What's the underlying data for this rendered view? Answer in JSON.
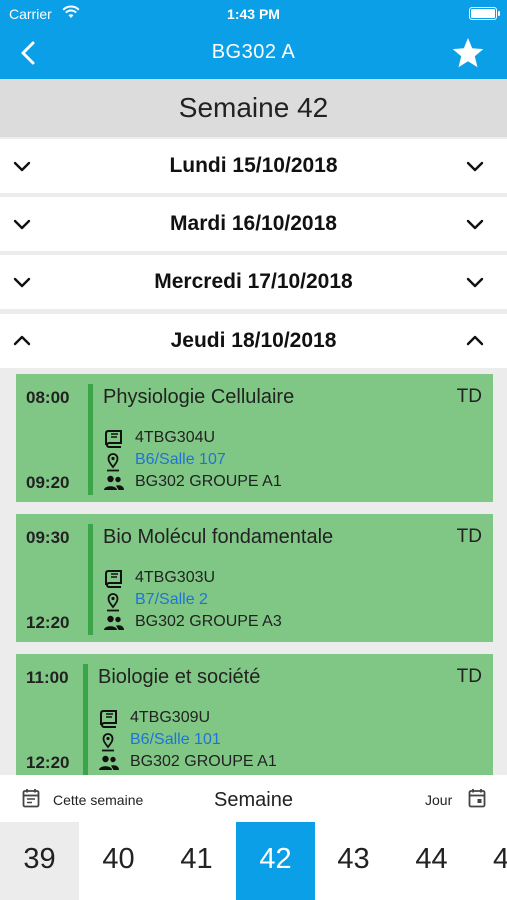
{
  "status": {
    "carrier": "Carrier",
    "time": "1:43 PM"
  },
  "nav": {
    "title": "BG302 A",
    "back_icon": "chevron-left-icon",
    "favorite_icon": "star-icon"
  },
  "week_title": "Semaine 42",
  "days": [
    {
      "label": "Lundi 15/10/2018",
      "expanded": false
    },
    {
      "label": "Mardi 16/10/2018",
      "expanded": false
    },
    {
      "label": "Mercredi 17/10/2018",
      "expanded": false
    },
    {
      "label": "Jeudi 18/10/2018",
      "expanded": true
    }
  ],
  "courses": [
    {
      "start": "08:00",
      "end": "09:20",
      "name": "Physiologie Cellulaire",
      "type": "TD",
      "code": "4TBG304U",
      "room": "B6/Salle 107",
      "group": "BG302 GROUPE A1"
    },
    {
      "start": "09:30",
      "end": "12:20",
      "name": "Bio Molécul fondamentale",
      "type": "TD",
      "code": "4TBG303U",
      "room": "B7/Salle 2",
      "group": "BG302 GROUPE A3"
    },
    {
      "start": "11:00",
      "end": "12:20",
      "name": "Biologie et société",
      "type": "TD",
      "code": "4TBG309U",
      "room": "B6/Salle 101",
      "group": "BG302 GROUPE A1"
    }
  ],
  "bottom": {
    "this_week": "Cette semaine",
    "mode": "Semaine",
    "day": "Jour",
    "weeks": [
      "39",
      "40",
      "41",
      "42",
      "43",
      "44",
      "4"
    ],
    "active_week": "42"
  },
  "colors": {
    "accent": "#0a9fe6",
    "card": "#80c785",
    "card_bar": "#3aa54a",
    "link": "#1f73d8"
  }
}
